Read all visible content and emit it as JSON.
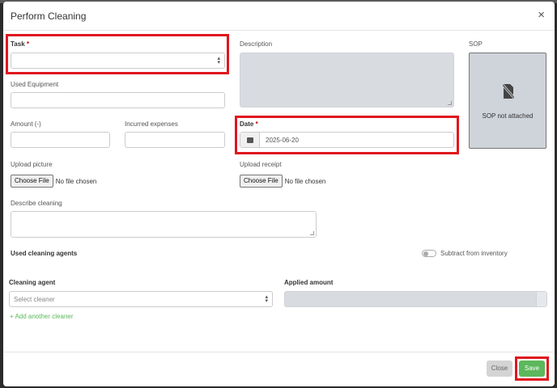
{
  "modal": {
    "title": "Perform Cleaning",
    "close_symbol": "×"
  },
  "form": {
    "task_label": "Task",
    "required_mark": "*",
    "task_value": "",
    "description_label": "Description",
    "sop_label": "SOP",
    "sop_status": "SOP not attached",
    "sop_icon": "file-slash-icon",
    "used_equipment_label": "Used Equipment",
    "amount_label": "Amount (-)",
    "incurred_expenses_label": "Incurred expenses",
    "date_label": "Date",
    "date_value": "2025-06-20",
    "date_icon": "calendar-icon",
    "upload_picture_label": "Upload picture",
    "upload_receipt_label": "Upload receipt",
    "choose_file_label": "Choose File",
    "no_file_text": "No file chosen",
    "describe_cleaning_label": "Describe cleaning"
  },
  "agents": {
    "section_title": "Used cleaning agents",
    "subtract_toggle_label": "Subtract from inventory",
    "subtract_toggle_on": false,
    "cleaning_agent_label": "Cleaning agent",
    "cleaning_agent_placeholder": "Select cleaner",
    "applied_amount_label": "Applied amount",
    "add_link": "+ Add another cleaner"
  },
  "footer": {
    "close_label": "Close",
    "save_label": "Save"
  },
  "colors": {
    "highlight": "#e0161d",
    "save_button": "#5cb85c",
    "link": "#5bb85b"
  }
}
